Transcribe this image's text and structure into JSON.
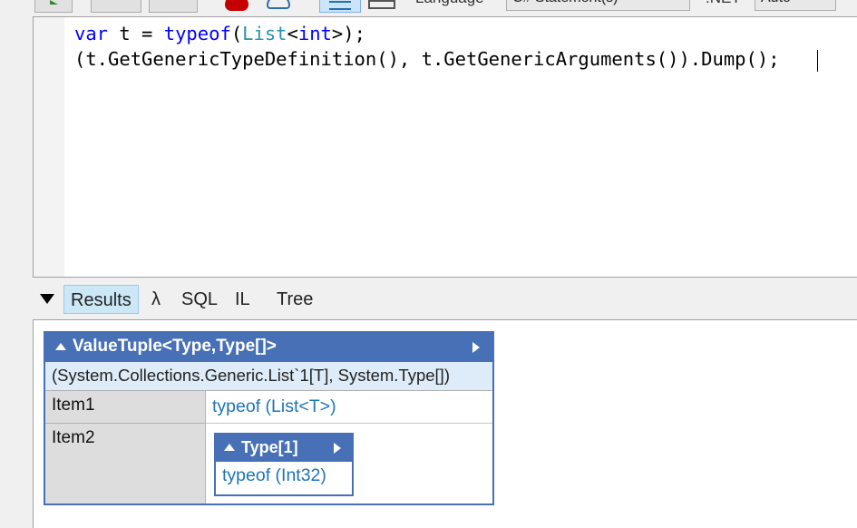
{
  "toolbar": {
    "language_label": "Language",
    "language_value": "C# Statement(s)",
    "dotnet_label": ".NET",
    "dotnet_value": "Auto"
  },
  "editor": {
    "lines": [
      [
        {
          "t": "var",
          "c": "kw"
        },
        {
          "t": " t = ",
          "c": ""
        },
        {
          "t": "typeof",
          "c": "kw"
        },
        {
          "t": "(",
          "c": ""
        },
        {
          "t": "List",
          "c": "ty"
        },
        {
          "t": "<",
          "c": ""
        },
        {
          "t": "int",
          "c": "kw"
        },
        {
          "t": ">);",
          "c": ""
        }
      ],
      [
        {
          "t": "(t.GetGenericTypeDefinition(), t.GetGenericArguments()).Dump();",
          "c": ""
        }
      ]
    ]
  },
  "results_tabs": {
    "results": "Results",
    "lambda": "λ",
    "sql": "SQL",
    "il": "IL",
    "tree": "Tree"
  },
  "dump": {
    "header": "ValueTuple<Type,Type[]>",
    "subtitle": "(System.Collections.Generic.List`1[T], System.Type[])",
    "rows": [
      {
        "label": "Item1",
        "value": "typeof (List<T>)"
      },
      {
        "label": "Item2",
        "nested_header": "Type[1]",
        "nested_value": "typeof (Int32)"
      }
    ]
  },
  "colors": {
    "accent": "#4770b6",
    "link": "#1e74b8",
    "keyword": "#0000ff",
    "type": "#2b91af"
  }
}
